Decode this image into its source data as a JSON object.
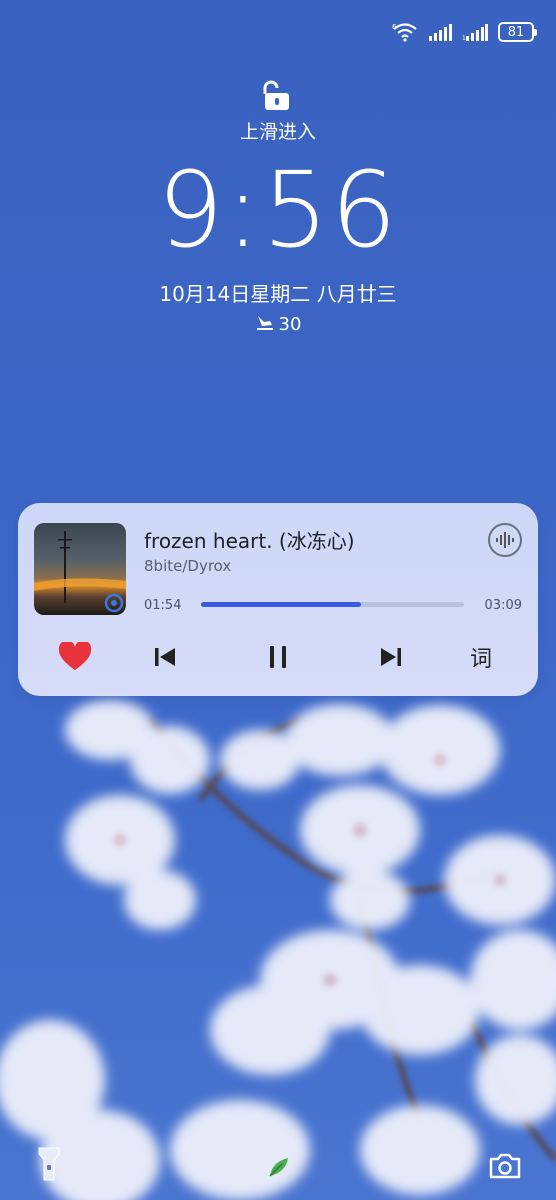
{
  "status_bar": {
    "wifi_icon": "wifi-6-icon",
    "signal_icons": [
      "signal-bars-icon",
      "signal-bars-icon"
    ],
    "battery_level": "81"
  },
  "lockscreen": {
    "unlock_hint": "上滑进入",
    "time": "9:56",
    "date": "10月14日星期二 八月廿三",
    "steps_icon": "footsteps-icon",
    "steps": "30"
  },
  "music": {
    "title": "frozen heart. (冰冻心)",
    "artist": "8bite/Dyrox",
    "elapsed": "01:54",
    "duration": "03:09",
    "progress": 0.61,
    "like_icon": "heart-icon",
    "prev_icon": "skip-previous-icon",
    "pause_icon": "pause-icon",
    "next_icon": "skip-next-icon",
    "lyrics_label": "词",
    "audio_icon": "audio-output-icon",
    "accent_color": "#3a5bdb",
    "like_color": "#e8323c"
  },
  "bottom": {
    "left_icon": "flashlight-icon",
    "center_icon": "leaf-icon",
    "right_icon": "camera-icon"
  }
}
